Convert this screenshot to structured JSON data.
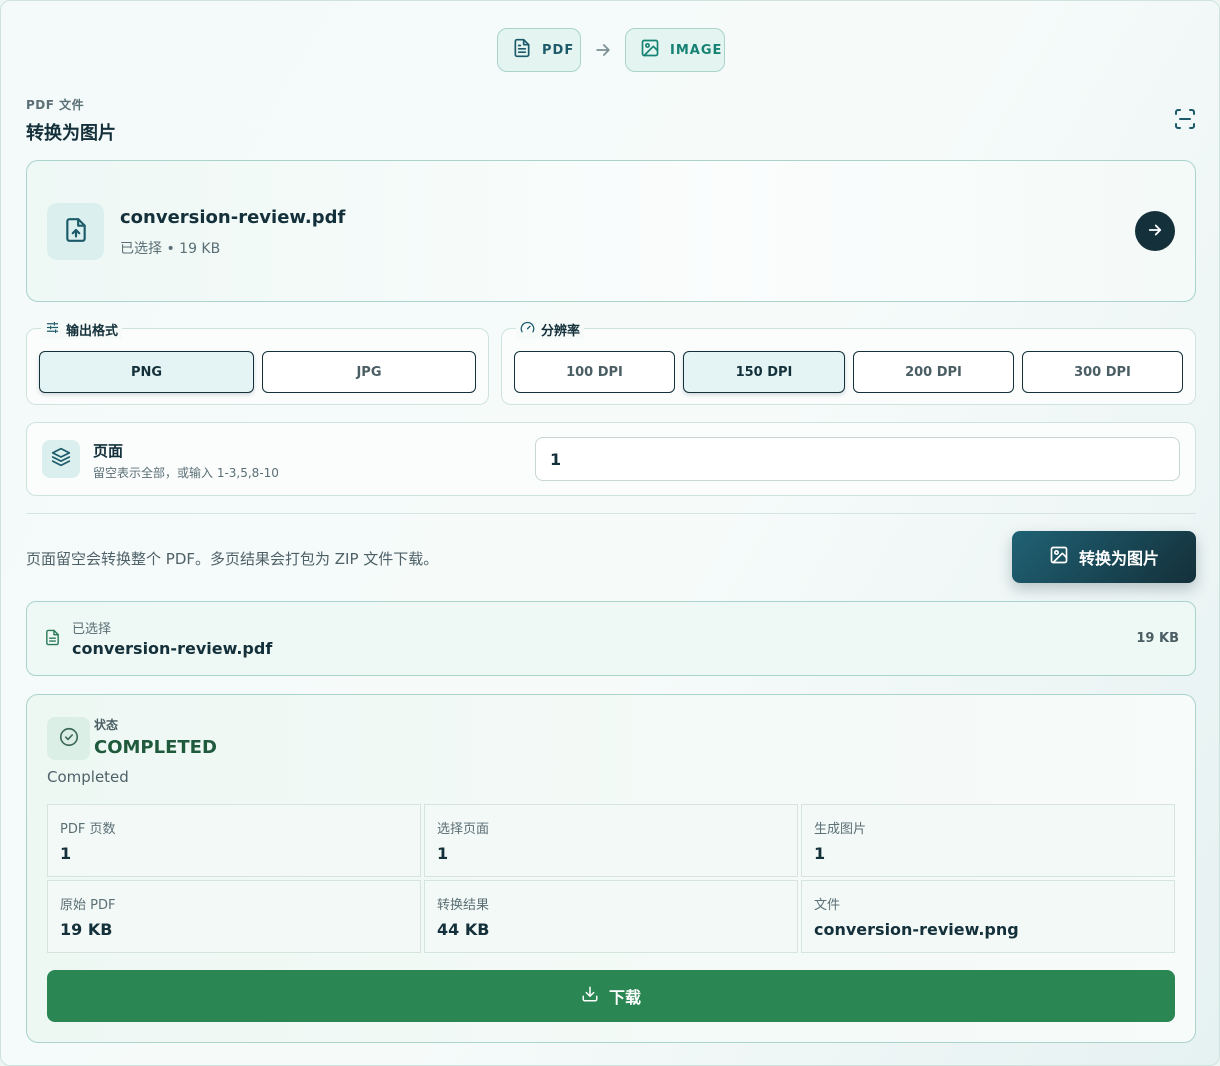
{
  "flow": {
    "from_label": "PDF",
    "to_label": "IMAGE"
  },
  "header": {
    "eyebrow": "PDF 文件",
    "title": "转换为图片"
  },
  "file": {
    "name": "conversion-review.pdf",
    "status": "已选择",
    "size": "19 KB"
  },
  "format": {
    "legend": "输出格式",
    "options": [
      "PNG",
      "JPG"
    ],
    "selected": "PNG"
  },
  "resolution": {
    "legend": "分辨率",
    "options": [
      "100 DPI",
      "150 DPI",
      "200 DPI",
      "300 DPI"
    ],
    "selected": "150 DPI"
  },
  "pages": {
    "title": "页面",
    "hint": "留空表示全部，或输入 1-3,5,8-10",
    "value": "1"
  },
  "note": "页面留空会转换整个 PDF。多页结果会打包为 ZIP 文件下载。",
  "convert_button": "转换为图片",
  "selected_file": {
    "label": "已选择",
    "name": "conversion-review.pdf",
    "size": "19 KB"
  },
  "status": {
    "label": "状态",
    "value": "COMPLETED",
    "text": "Completed",
    "stats": [
      {
        "label": "PDF 页数",
        "value": "1"
      },
      {
        "label": "选择页面",
        "value": "1"
      },
      {
        "label": "生成图片",
        "value": "1"
      },
      {
        "label": "原始 PDF",
        "value": "19 KB"
      },
      {
        "label": "转换结果",
        "value": "44 KB"
      },
      {
        "label": "文件",
        "value": "conversion-review.png"
      }
    ]
  },
  "download_button": "下载",
  "colors": {
    "primary_dark": "#14303a",
    "accent_teal": "#168273",
    "success_green": "#2a8653"
  }
}
